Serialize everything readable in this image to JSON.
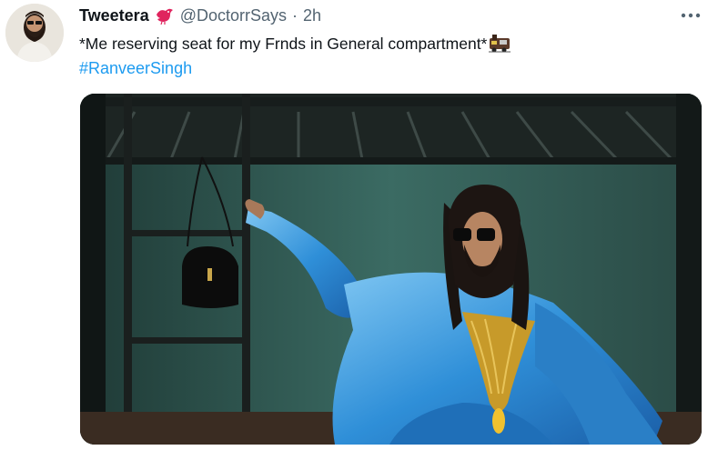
{
  "tweet": {
    "display_name": "Tweetera",
    "handle": "@DoctorrSays",
    "separator": "·",
    "time": "2h",
    "text": "*Me reserving seat for my Frnds in General compartment*",
    "hashtag": "#RanveerSingh"
  },
  "icons": {
    "display_name_badge": "red-bird-icon",
    "text_emoji": "train-icon",
    "menu": "more-icon"
  },
  "colors": {
    "link": "#1d9bf0",
    "secondary_text": "#536471",
    "primary_text": "#0f1419"
  }
}
